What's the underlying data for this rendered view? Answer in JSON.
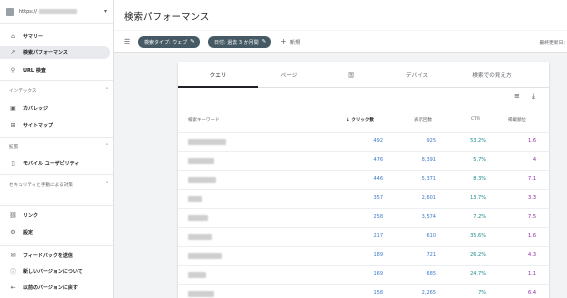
{
  "sidebar": {
    "property_url": "https://",
    "items_main": [
      {
        "icon": "home-icon",
        "glyph": "⌂",
        "label": "サマリー"
      },
      {
        "icon": "trend-icon",
        "glyph": "↗",
        "label": "検索パフォーマンス",
        "active": true
      },
      {
        "icon": "search-icon",
        "glyph": "⚲",
        "label": "URL 検査"
      }
    ],
    "section_index": "インデックス",
    "items_index": [
      {
        "icon": "coverage-icon",
        "glyph": "▣",
        "label": "カバレッジ"
      },
      {
        "icon": "sitemap-icon",
        "glyph": "⊞",
        "label": "サイトマップ"
      }
    ],
    "section_enh": "拡張",
    "items_enh": [
      {
        "icon": "mobile-icon",
        "glyph": "▯",
        "label": "モバイル ユーザビリティ"
      }
    ],
    "section_sec": "セキュリティと手動による対策",
    "items_bottom": [
      {
        "icon": "links-icon",
        "glyph": "⛓",
        "label": "リンク"
      },
      {
        "icon": "settings-icon",
        "glyph": "⚙",
        "label": "設定"
      }
    ],
    "items_footer": [
      {
        "icon": "feedback-icon",
        "glyph": "✉",
        "label": "フィードバックを送信"
      },
      {
        "icon": "info-icon",
        "glyph": "ⓘ",
        "label": "新しいバージョンについて"
      },
      {
        "icon": "exit-icon",
        "glyph": "⇤",
        "label": "以前のバージョンに戻す"
      }
    ]
  },
  "header": {
    "title": "検索パフォーマンス"
  },
  "filters": {
    "chips": [
      "検索タイプ: ウェブ",
      "日付: 過去 3 か月間"
    ],
    "add_label": "新規",
    "updated_label": "最終更新日:"
  },
  "tabs": [
    "クエリ",
    "ページ",
    "国",
    "デバイス",
    "検索での見え方"
  ],
  "table": {
    "headers": {
      "keyword": "検索キーワード",
      "clicks": "クリック数",
      "impressions": "表示回数",
      "ctr": "CTR",
      "position": "掲載順位"
    },
    "rows": [
      {
        "clicks": "492",
        "impressions": "925",
        "ctr": "53.2%",
        "position": "1.6"
      },
      {
        "clicks": "476",
        "impressions": "8,391",
        "ctr": "5.7%",
        "position": "4"
      },
      {
        "clicks": "446",
        "impressions": "5,371",
        "ctr": "8.3%",
        "position": "7.1"
      },
      {
        "clicks": "357",
        "impressions": "2,601",
        "ctr": "13.7%",
        "position": "3.3"
      },
      {
        "clicks": "258",
        "impressions": "3,574",
        "ctr": "7.2%",
        "position": "7.5"
      },
      {
        "clicks": "217",
        "impressions": "610",
        "ctr": "35.6%",
        "position": "1.6"
      },
      {
        "clicks": "189",
        "impressions": "721",
        "ctr": "26.2%",
        "position": "4.3"
      },
      {
        "clicks": "169",
        "impressions": "685",
        "ctr": "24.7%",
        "position": "1.1"
      },
      {
        "clicks": "158",
        "impressions": "2,265",
        "ctr": "7%",
        "position": "6.4"
      }
    ]
  }
}
